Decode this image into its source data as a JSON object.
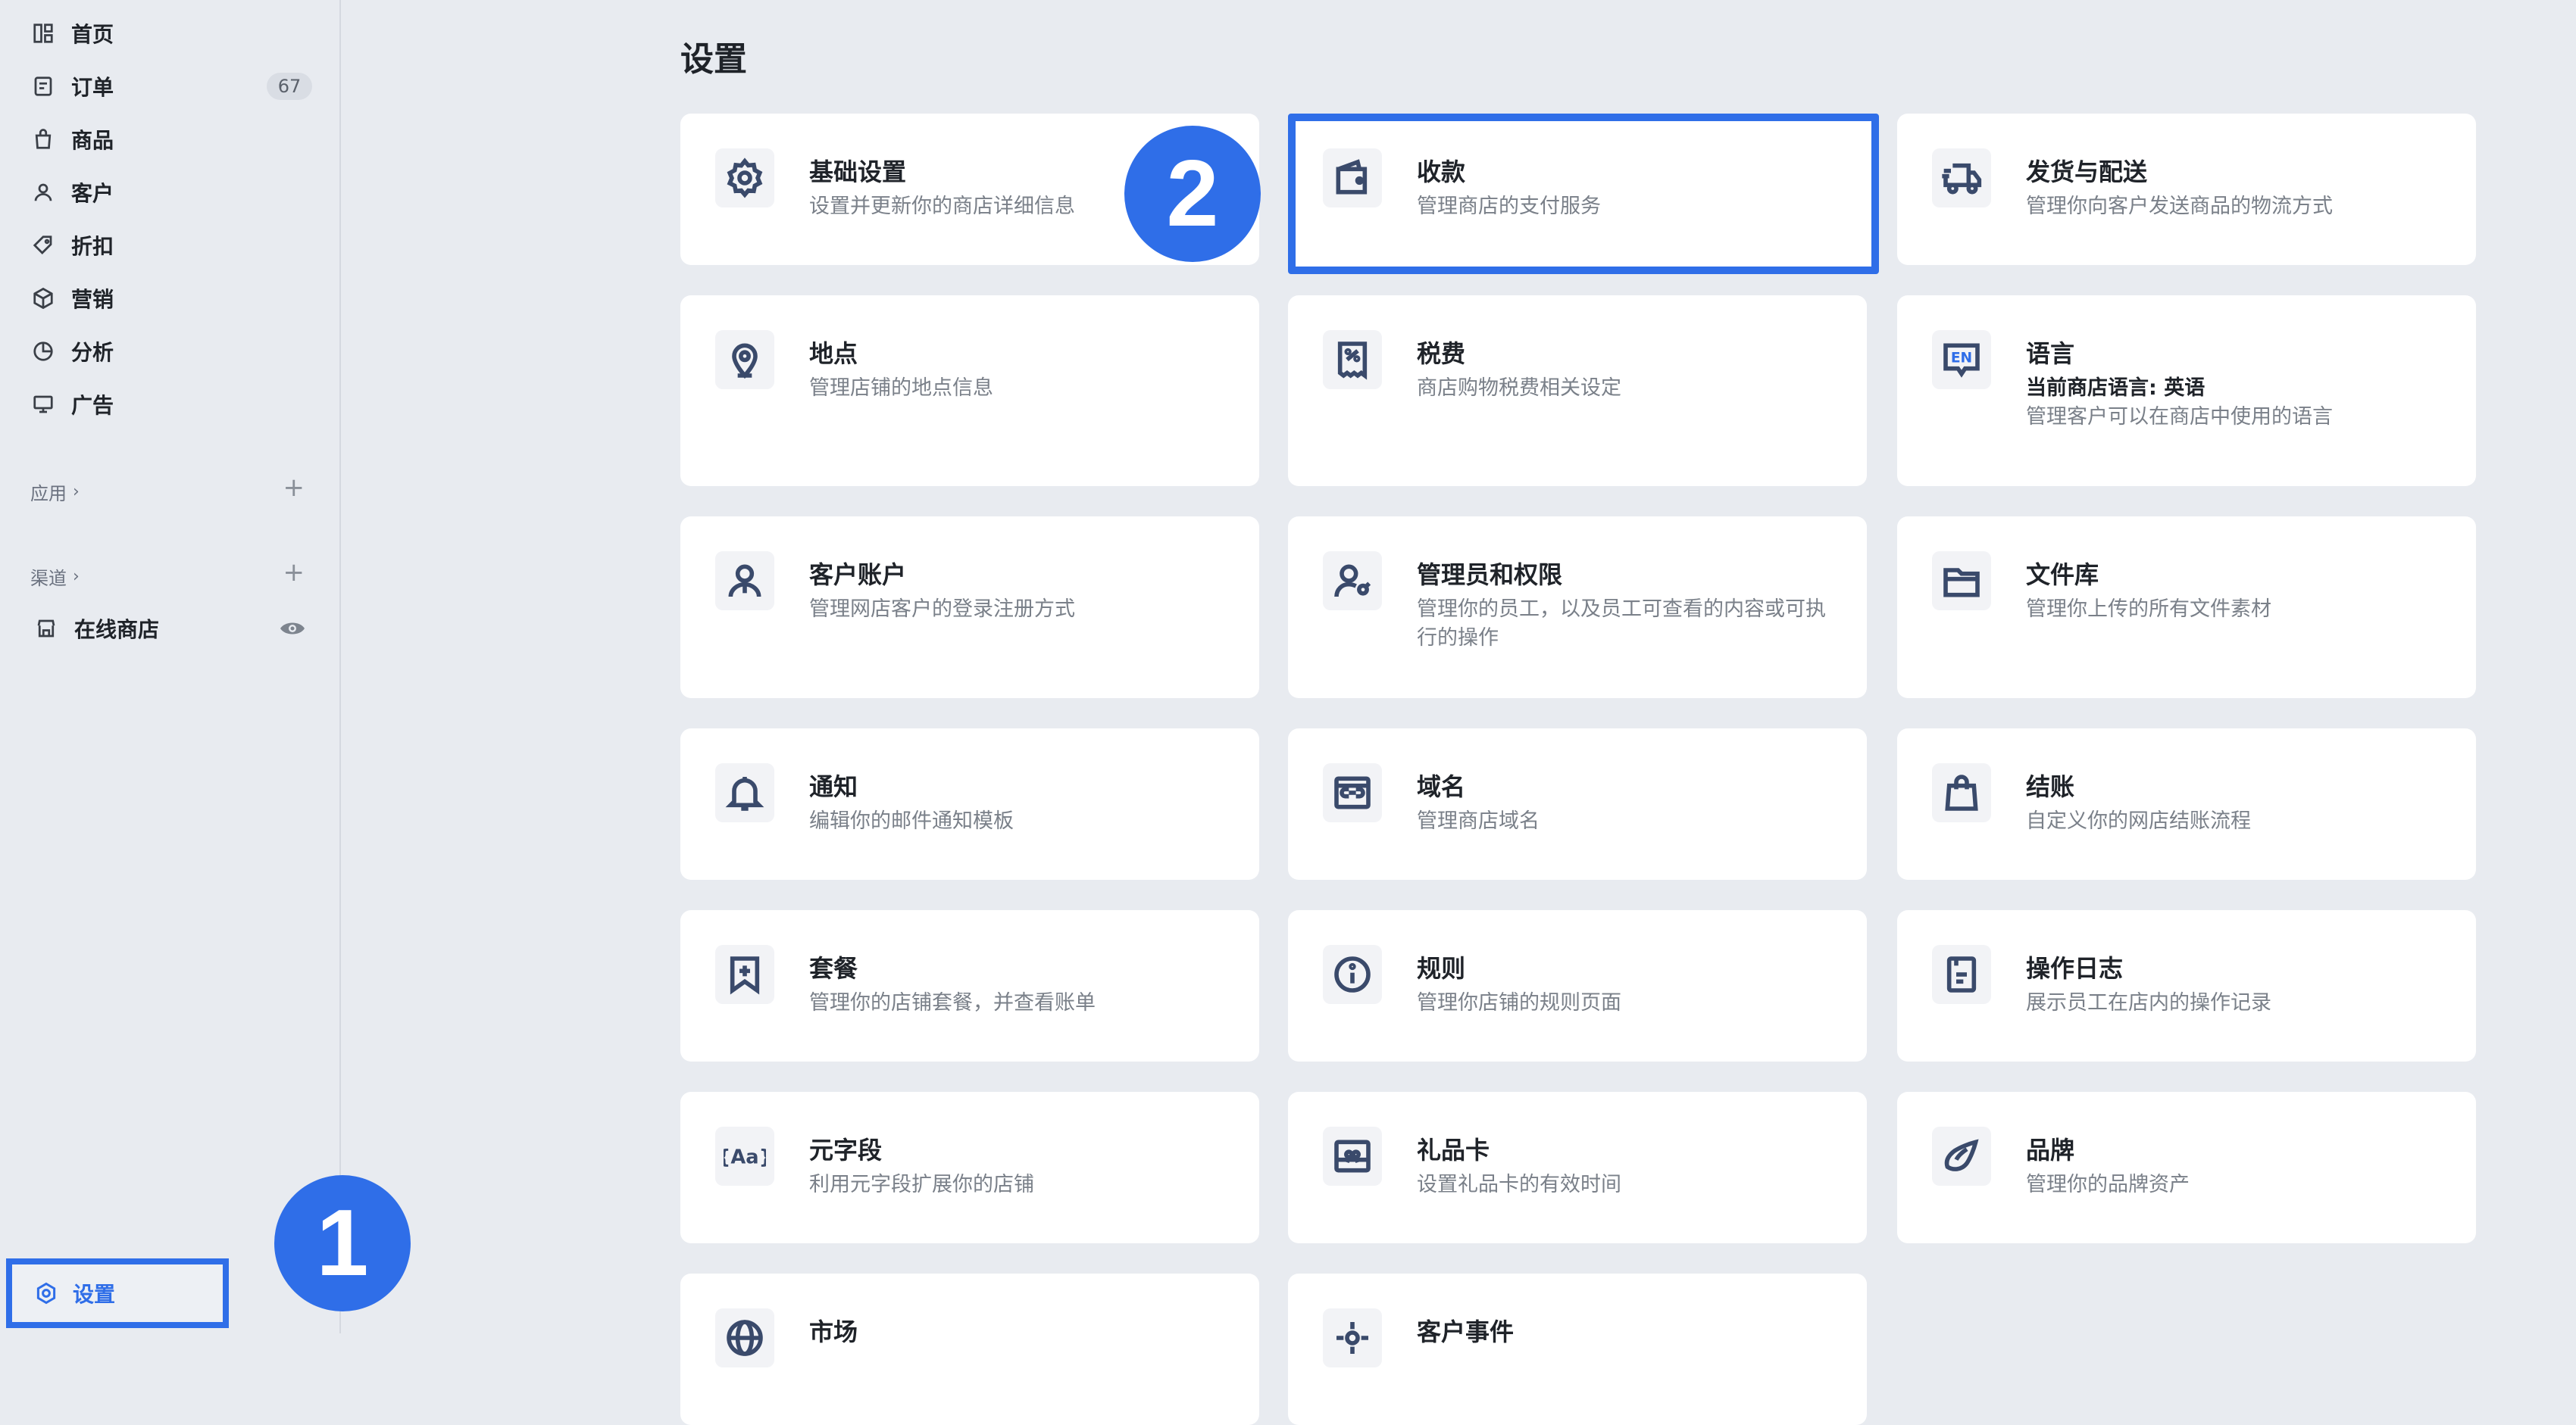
{
  "sidebar": {
    "items": [
      {
        "label": "首页",
        "icon": "home-icon"
      },
      {
        "label": "订单",
        "icon": "orders-icon",
        "badge": "67"
      },
      {
        "label": "商品",
        "icon": "products-icon"
      },
      {
        "label": "客户",
        "icon": "customers-icon"
      },
      {
        "label": "折扣",
        "icon": "discount-icon"
      },
      {
        "label": "营销",
        "icon": "marketing-icon"
      },
      {
        "label": "分析",
        "icon": "analytics-icon"
      },
      {
        "label": "广告",
        "icon": "ads-icon"
      }
    ],
    "apps_label": "应用",
    "channels_label": "渠道",
    "online_store_label": "在线商店",
    "settings_label": "设置"
  },
  "markers": {
    "one": "1",
    "two": "2"
  },
  "page": {
    "title": "设置"
  },
  "cards": [
    {
      "title": "基础设置",
      "desc": "设置并更新你的商店详细信息",
      "icon": "gear-icon"
    },
    {
      "title": "收款",
      "desc": "管理商店的支付服务",
      "icon": "wallet-icon"
    },
    {
      "title": "发货与配送",
      "desc": "管理你向客户发送商品的物流方式",
      "icon": "truck-icon"
    },
    {
      "title": "地点",
      "desc": "管理店铺的地点信息",
      "icon": "location-pin-icon"
    },
    {
      "title": "税费",
      "desc": "商店购物税费相关设定",
      "icon": "receipt-icon"
    },
    {
      "title": "语言",
      "desc_bold": "当前商店语言: 英语",
      "desc": "管理客户可以在商店中使用的语言",
      "icon": "language-icon"
    },
    {
      "title": "客户账户",
      "desc": "管理网店客户的登录注册方式",
      "icon": "user-icon"
    },
    {
      "title": "管理员和权限",
      "desc": "管理你的员工，以及员工可查看的内容或可执行的操作",
      "icon": "user-key-icon"
    },
    {
      "title": "文件库",
      "desc": "管理你上传的所有文件素材",
      "icon": "folder-icon"
    },
    {
      "title": "通知",
      "desc": "编辑你的邮件通知模板",
      "icon": "bell-icon"
    },
    {
      "title": "域名",
      "desc": "管理商店域名",
      "icon": "domain-icon"
    },
    {
      "title": "结账",
      "desc": "自定义你的网店结账流程",
      "icon": "shopping-bag-icon"
    },
    {
      "title": "套餐",
      "desc": "管理你的店铺套餐，并查看账单",
      "icon": "bookmark-plus-icon"
    },
    {
      "title": "规则",
      "desc": "管理你店铺的规则页面",
      "icon": "info-icon"
    },
    {
      "title": "操作日志",
      "desc": "展示员工在店内的操作记录",
      "icon": "log-icon"
    },
    {
      "title": "元字段",
      "desc": "利用元字段扩展你的店铺",
      "icon": "metafield-icon"
    },
    {
      "title": "礼品卡",
      "desc": "设置礼品卡的有效时间",
      "icon": "gift-card-icon"
    },
    {
      "title": "品牌",
      "desc": "管理你的品牌资产",
      "icon": "brand-icon"
    },
    {
      "title": "市场",
      "desc": "",
      "icon": "globe-icon"
    },
    {
      "title": "客户事件",
      "desc": "",
      "icon": "events-icon"
    }
  ]
}
